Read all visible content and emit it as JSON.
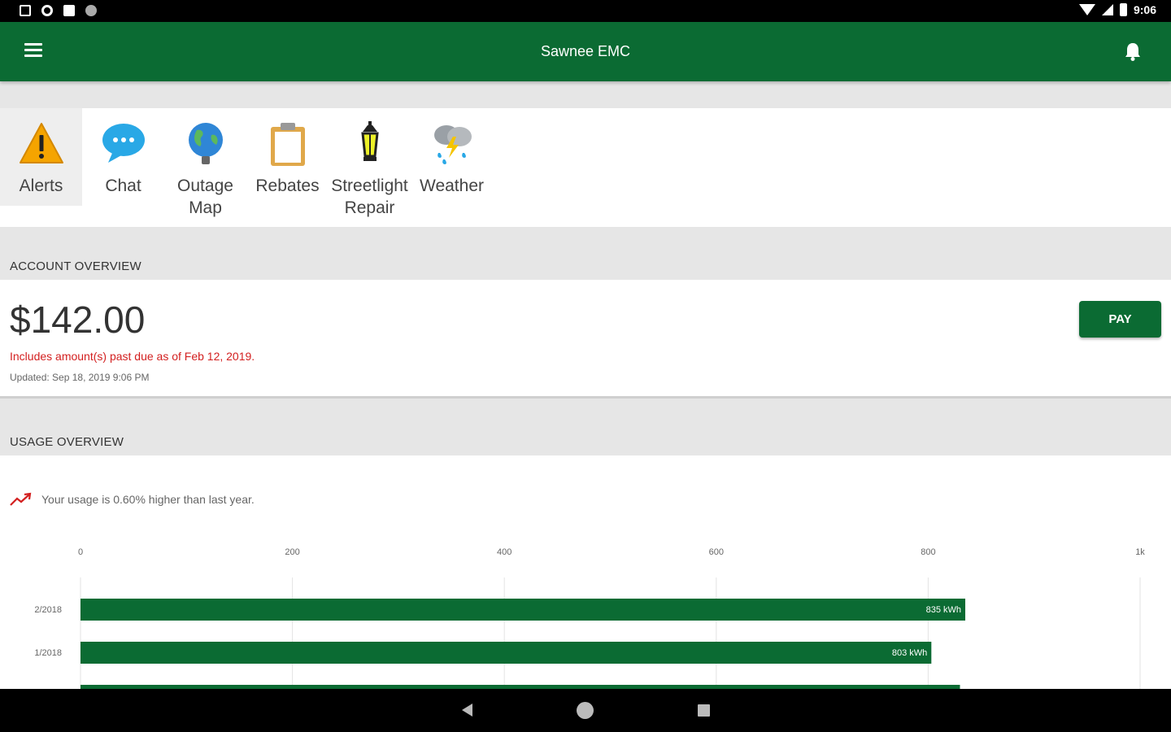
{
  "status_bar": {
    "time": "9:06"
  },
  "app_bar": {
    "title": "Sawnee EMC",
    "menu_icon": "menu-icon",
    "bell_icon": "bell-icon"
  },
  "quick_actions": [
    {
      "label": "Alerts",
      "icon": "warning-icon"
    },
    {
      "label": "Chat",
      "icon": "chat-bubble-icon"
    },
    {
      "label": "Outage Map",
      "icon": "globe-icon"
    },
    {
      "label": "Rebates",
      "icon": "clipboard-icon"
    },
    {
      "label": "Streetlight Repair",
      "icon": "lantern-icon"
    },
    {
      "label": "Weather",
      "icon": "storm-cloud-icon"
    }
  ],
  "account_overview": {
    "header": "ACCOUNT OVERVIEW",
    "amount": "$142.00",
    "past_due": "Includes amount(s) past due as of Feb 12, 2019.",
    "updated": "Updated:  Sep 18, 2019 9:06 PM",
    "pay_label": "PAY"
  },
  "usage_overview": {
    "header": "USAGE OVERVIEW",
    "trend_text": "Your usage is 0.60% higher than last year."
  },
  "colors": {
    "brand_green": "#0b6b33",
    "alert_red": "#d32020"
  },
  "chart_data": {
    "type": "bar",
    "orientation": "horizontal",
    "axis_ticks": [
      "0",
      "200",
      "400",
      "600",
      "800",
      "1k"
    ],
    "xlim": [
      0,
      1000
    ],
    "categories": [
      "2/2018",
      "1/2018",
      ""
    ],
    "values": [
      835,
      803,
      830
    ],
    "value_labels": [
      "835 kWh",
      "803 kWh",
      ""
    ],
    "grid": true
  }
}
